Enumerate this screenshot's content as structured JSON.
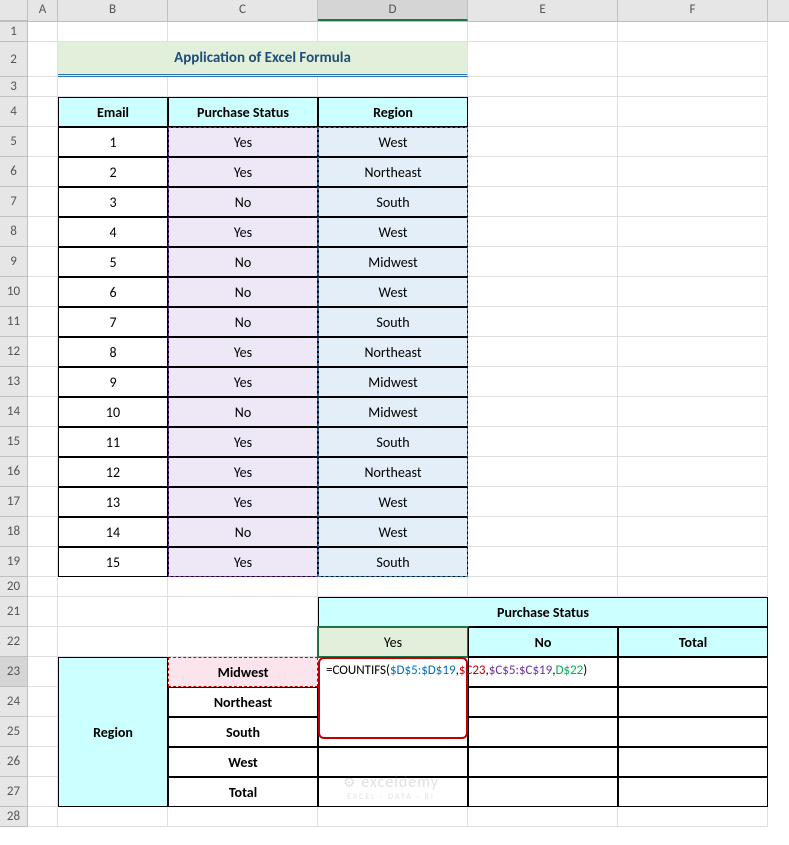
{
  "columns": [
    "A",
    "B",
    "C",
    "D",
    "E",
    "F"
  ],
  "colWidths": {
    "A": 30,
    "B": 110,
    "C": 150,
    "D": 150,
    "E": 150,
    "F": 150
  },
  "rowHeights": {
    "1": 20,
    "2": 35,
    "3": 20,
    "4": 30,
    "5": 30,
    "6": 30,
    "7": 30,
    "8": 30,
    "9": 30,
    "10": 30,
    "11": 30,
    "12": 30,
    "13": 30,
    "14": 30,
    "15": 30,
    "16": 30,
    "17": 30,
    "18": 30,
    "19": 30,
    "20": 20,
    "21": 30,
    "22": 30,
    "23": 30,
    "24": 30,
    "25": 30,
    "26": 30,
    "27": 30,
    "28": 20
  },
  "selectedCol": "D",
  "selectedRow": 23,
  "title": "Application of Excel Formula",
  "table1": {
    "headers": [
      "Email",
      "Purchase Status",
      "Region"
    ],
    "rows": [
      {
        "email": "1",
        "status": "Yes",
        "region": "West"
      },
      {
        "email": "2",
        "status": "Yes",
        "region": "Northeast"
      },
      {
        "email": "3",
        "status": "No",
        "region": "South"
      },
      {
        "email": "4",
        "status": "Yes",
        "region": "West"
      },
      {
        "email": "5",
        "status": "No",
        "region": "Midwest"
      },
      {
        "email": "6",
        "status": "No",
        "region": "West"
      },
      {
        "email": "7",
        "status": "No",
        "region": "South"
      },
      {
        "email": "8",
        "status": "Yes",
        "region": "Northeast"
      },
      {
        "email": "9",
        "status": "Yes",
        "region": "Midwest"
      },
      {
        "email": "10",
        "status": "No",
        "region": "Midwest"
      },
      {
        "email": "11",
        "status": "Yes",
        "region": "South"
      },
      {
        "email": "12",
        "status": "Yes",
        "region": "Northeast"
      },
      {
        "email": "13",
        "status": "Yes",
        "region": "West"
      },
      {
        "email": "14",
        "status": "No",
        "region": "West"
      },
      {
        "email": "15",
        "status": "Yes",
        "region": "South"
      }
    ]
  },
  "table2": {
    "purchaseHeader": "Purchase Status",
    "colHeaders": [
      "Yes",
      "No",
      "Total"
    ],
    "regionHeader": "Region",
    "rowHeaders": [
      "Midwest",
      "Northeast",
      "South",
      "West",
      "Total"
    ]
  },
  "formula": {
    "prefix": "=COUNTIFS(",
    "p1": "$D$5:$D$19",
    "c1": ",",
    "p2": "$C23",
    "c2": ",",
    "p3": "$C$5:$C$19",
    "c3": ",",
    "p4": "D$22",
    "suffix": ")"
  },
  "watermark": {
    "top": "exceldemy",
    "sub": "EXCEL · DATA · BI"
  }
}
